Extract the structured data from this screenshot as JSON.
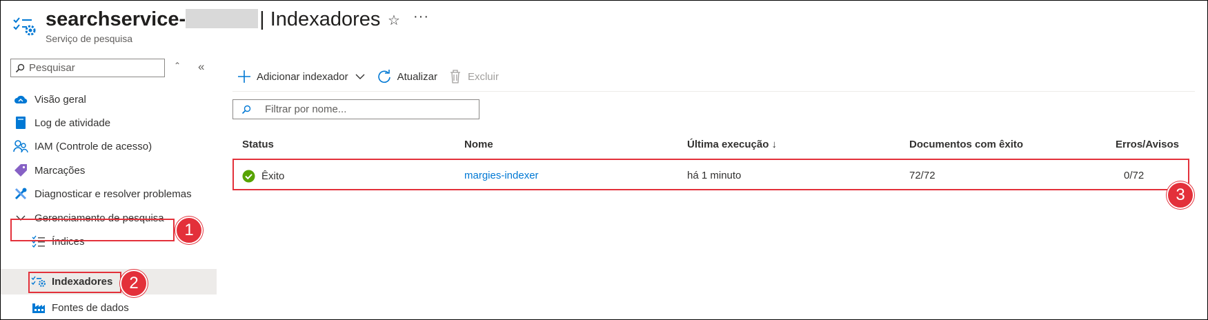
{
  "header": {
    "service_name": "searchservice-",
    "page_title": "| Indexadores",
    "subtitle": "Serviço de pesquisa",
    "favorite_icon": "star-icon",
    "more_icon": "ellipsis-icon",
    "more_label": "···",
    "star_glyph": "☆"
  },
  "sidebar": {
    "search_placeholder": "Pesquisar",
    "updown_glyph": "⌃⌄",
    "collapse_glyph": "«",
    "items": [
      {
        "label": "Visão geral",
        "icon": "cloud-icon"
      },
      {
        "label": "Log de atividade",
        "icon": "log-icon"
      },
      {
        "label": "IAM (Controle de acesso)",
        "icon": "people-icon"
      },
      {
        "label": "Marcações",
        "icon": "tag-icon"
      },
      {
        "label": "Diagnosticar e resolver problemas",
        "icon": "wrench-icon"
      },
      {
        "label": "Gerenciamento de pesquisa",
        "icon": "chevron-down-icon"
      },
      {
        "label": "Índices",
        "icon": "list-check-icon"
      },
      {
        "label": "Indexadores",
        "icon": "indexer-icon"
      },
      {
        "label": "Fontes de dados",
        "icon": "factory-icon"
      }
    ]
  },
  "toolbar": {
    "add_label": "Adicionar indexador",
    "refresh_label": "Atualizar",
    "delete_label": "Excluir"
  },
  "filter": {
    "placeholder": "Filtrar por nome..."
  },
  "table": {
    "columns": [
      "Status",
      "Nome",
      "Última execução ↓",
      "Documentos com êxito",
      "Erros/Avisos"
    ],
    "rows": [
      {
        "status": "Êxito",
        "name": "margies-indexer",
        "last_run": "há 1 minuto",
        "docs_success": "72/72",
        "errors_warnings": "0/72"
      }
    ]
  },
  "callouts": [
    "1",
    "2",
    "3"
  ],
  "colors": {
    "accent": "#0078d4",
    "highlight": "#e3303a",
    "success": "#57a300",
    "active_bg": "#edebe9"
  }
}
